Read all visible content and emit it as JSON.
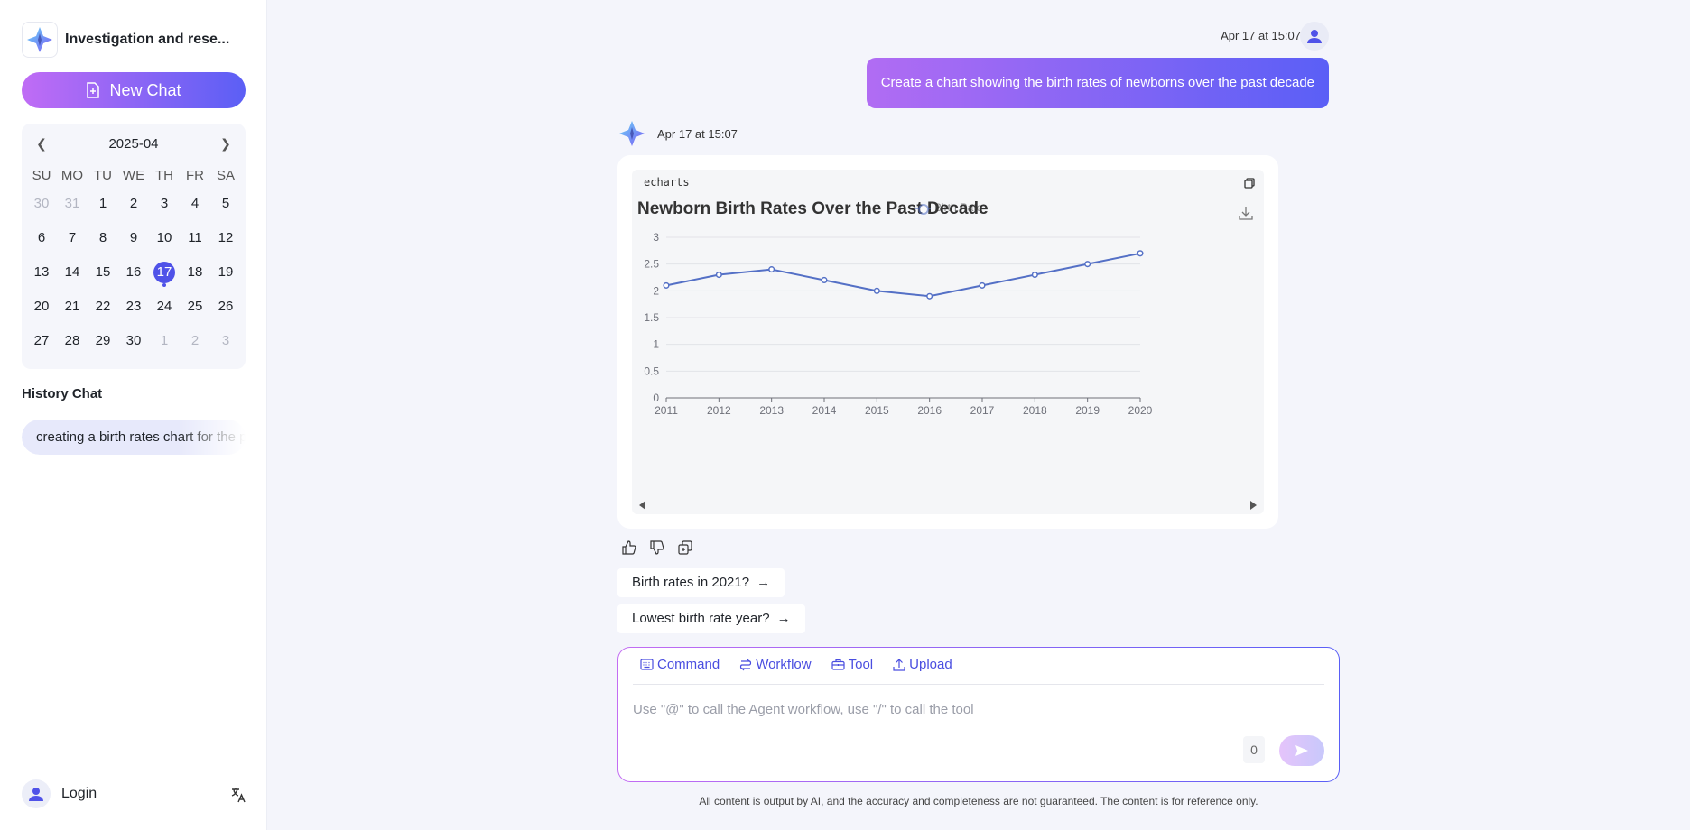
{
  "sidebar": {
    "app_title": "Investigation and rese...",
    "new_chat_label": "New Chat",
    "calendar": {
      "month": "2025-04",
      "weekdays": [
        "SU",
        "MO",
        "TU",
        "WE",
        "TH",
        "FR",
        "SA"
      ],
      "days": [
        {
          "d": "30",
          "muted": true
        },
        {
          "d": "31",
          "muted": true
        },
        {
          "d": "1"
        },
        {
          "d": "2"
        },
        {
          "d": "3"
        },
        {
          "d": "4"
        },
        {
          "d": "5"
        },
        {
          "d": "6"
        },
        {
          "d": "7"
        },
        {
          "d": "8"
        },
        {
          "d": "9"
        },
        {
          "d": "10"
        },
        {
          "d": "11"
        },
        {
          "d": "12"
        },
        {
          "d": "13"
        },
        {
          "d": "14"
        },
        {
          "d": "15"
        },
        {
          "d": "16"
        },
        {
          "d": "17",
          "today": true
        },
        {
          "d": "18"
        },
        {
          "d": "19"
        },
        {
          "d": "20"
        },
        {
          "d": "21"
        },
        {
          "d": "22"
        },
        {
          "d": "23"
        },
        {
          "d": "24"
        },
        {
          "d": "25"
        },
        {
          "d": "26"
        },
        {
          "d": "27"
        },
        {
          "d": "28"
        },
        {
          "d": "29"
        },
        {
          "d": "30"
        },
        {
          "d": "1",
          "muted": true
        },
        {
          "d": "2",
          "muted": true
        },
        {
          "d": "3",
          "muted": true
        }
      ]
    },
    "history_title": "History Chat",
    "history_items": [
      "creating a birth rates chart for the past decade"
    ],
    "login_label": "Login"
  },
  "chat": {
    "user_message": {
      "time": "Apr 17 at 15:07",
      "text": "Create a chart showing the birth rates of newborns over the past decade"
    },
    "bot_message": {
      "time": "Apr 17 at 15:07",
      "code_tag": "echarts"
    },
    "suggestions": [
      "Birth rates in 2021?",
      "Lowest birth rate year?"
    ]
  },
  "composer": {
    "tools": [
      "Command",
      "Workflow",
      "Tool",
      "Upload"
    ],
    "placeholder": "Use \"@\" to call the Agent workflow, use \"/\" to call the tool",
    "char_count": "0"
  },
  "disclaimer": "All content is output by AI, and the accuracy and completeness are not guaranteed. The content is for reference only.",
  "colors": {
    "accent": "#4f52e8",
    "gradient_start": "#c06cf5",
    "gradient_end": "#5b5ff5",
    "series_line": "#5470c6"
  },
  "chart_data": {
    "type": "line",
    "title": "Newborn Birth Rates Over the Past Decade",
    "legend": "Birth Rate",
    "legend_position": "top-center",
    "categories": [
      "2011",
      "2012",
      "2013",
      "2014",
      "2015",
      "2016",
      "2017",
      "2018",
      "2019",
      "2020"
    ],
    "series": [
      {
        "name": "Birth Rate",
        "values": [
          2.1,
          2.3,
          2.4,
          2.2,
          2.0,
          1.9,
          2.1,
          2.3,
          2.5,
          2.7
        ]
      }
    ],
    "y_ticks": [
      "0",
      "0.5",
      "1",
      "1.5",
      "2",
      "2.5",
      "3"
    ],
    "ylim": [
      0,
      3
    ],
    "grid": true
  }
}
